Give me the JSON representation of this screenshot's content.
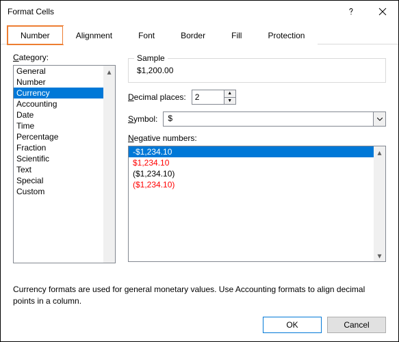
{
  "window": {
    "title": "Format Cells"
  },
  "tabs": [
    "Number",
    "Alignment",
    "Font",
    "Border",
    "Fill",
    "Protection"
  ],
  "activeTab": 0,
  "category": {
    "label": "Category:",
    "items": [
      "General",
      "Number",
      "Currency",
      "Accounting",
      "Date",
      "Time",
      "Percentage",
      "Fraction",
      "Scientific",
      "Text",
      "Special",
      "Custom"
    ],
    "selectedIndex": 2
  },
  "sample": {
    "label": "Sample",
    "value": "$1,200.00"
  },
  "decimal": {
    "label": "Decimal places:",
    "value": "2"
  },
  "symbol": {
    "label": "Symbol:",
    "value": "$"
  },
  "negative": {
    "label": "Negative numbers:",
    "items": [
      {
        "text": "-$1,234.10",
        "color": "#000000"
      },
      {
        "text": "$1,234.10",
        "color": "#ff0000"
      },
      {
        "text": "($1,234.10)",
        "color": "#000000"
      },
      {
        "text": "($1,234.10)",
        "color": "#ff0000"
      }
    ],
    "selectedIndex": 0
  },
  "description": "Currency formats are used for general monetary values.  Use Accounting formats to align decimal points in a column.",
  "buttons": {
    "ok": "OK",
    "cancel": "Cancel"
  }
}
